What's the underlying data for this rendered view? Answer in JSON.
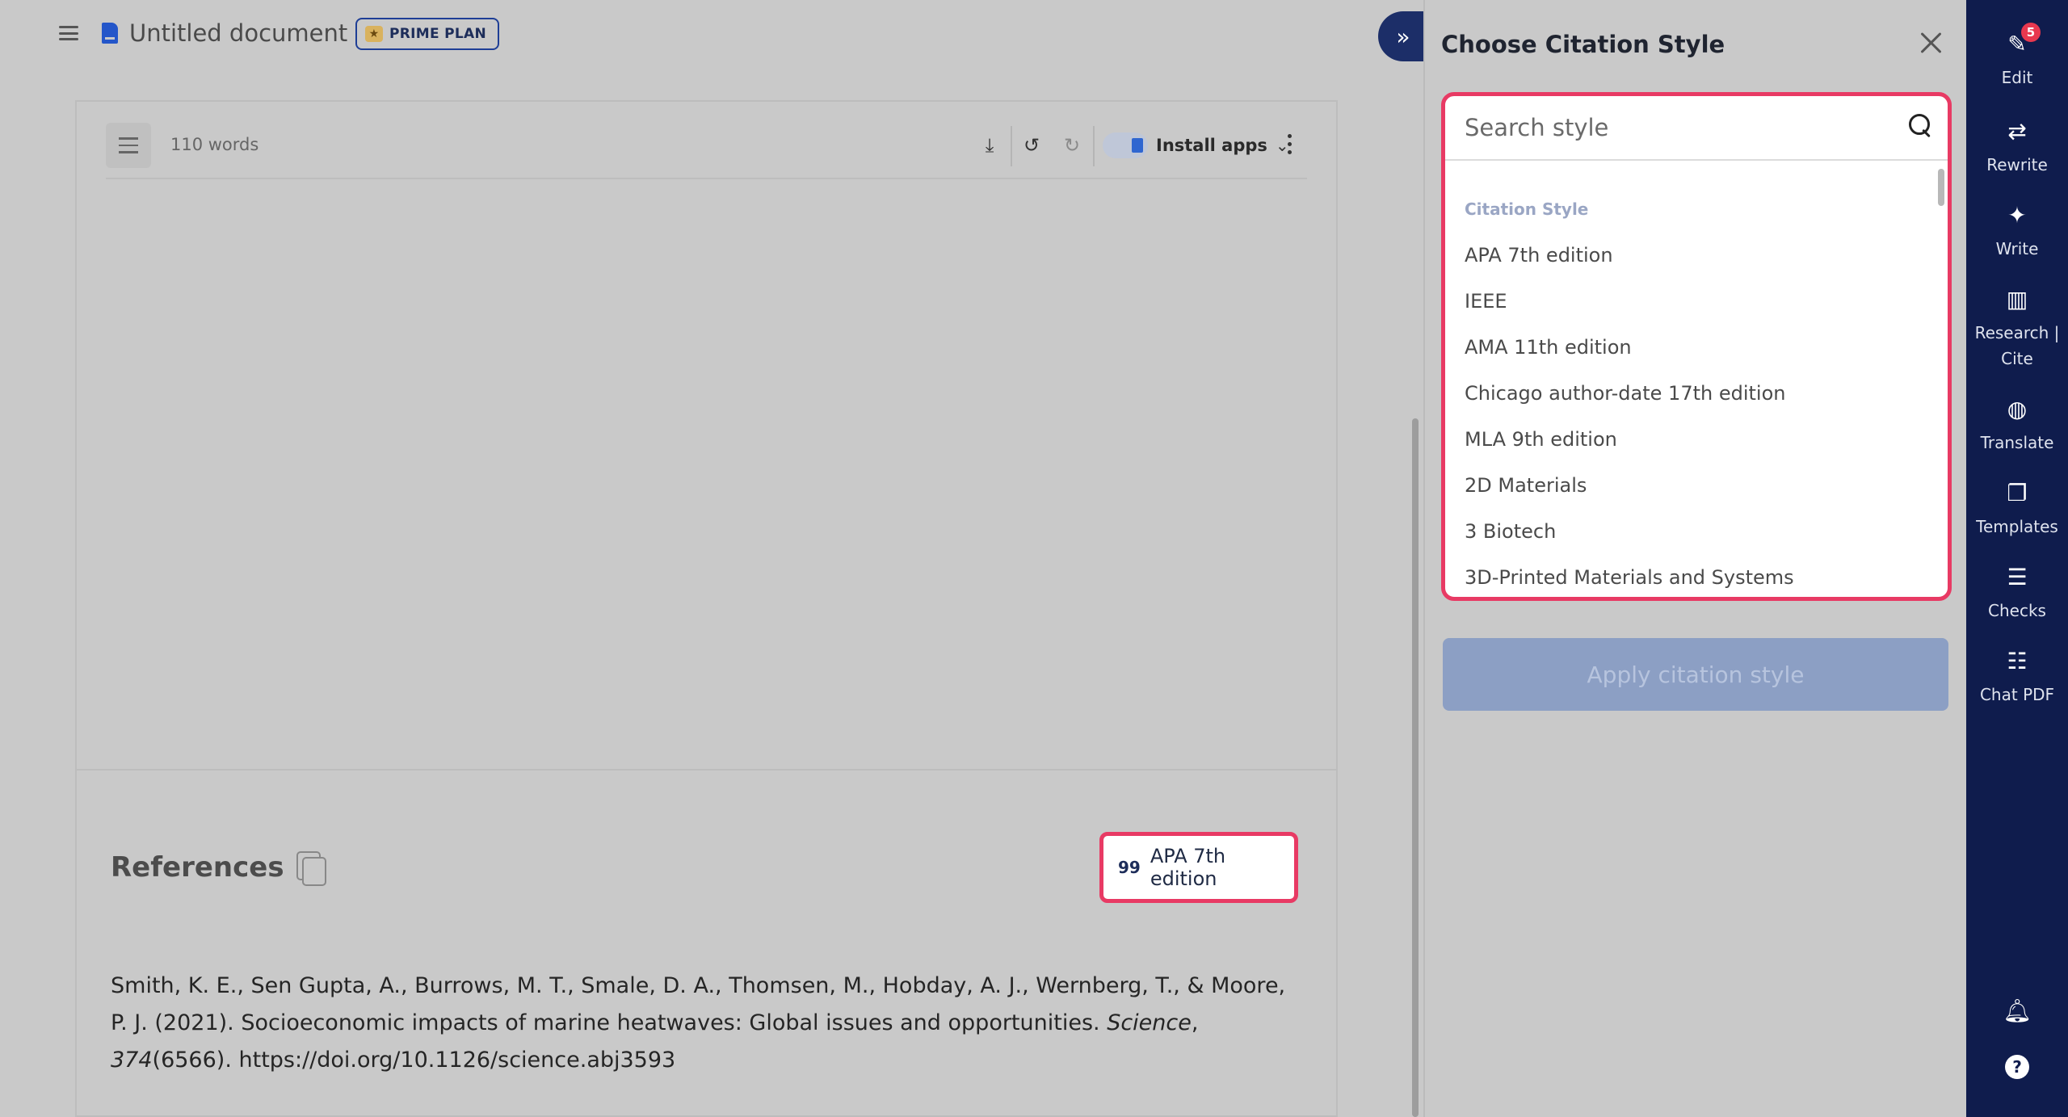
{
  "header": {
    "doc_title": "Untitled document",
    "plan_badge": "PRIME PLAN"
  },
  "editor": {
    "word_count": "110 words",
    "install_apps": "Install apps"
  },
  "references": {
    "title": "References",
    "style_chip_label": "APA 7th edition",
    "quote_glyph": "99",
    "entry_part1": "Smith, K. E., Sen Gupta, A., Burrows, M. T., Smale, D. A., Thomsen, M., Hobday, A. J., Wernberg, T., & Moore, P. J. (2021). Socioeconomic impacts of marine heatwaves: Global issues and opportunities. ",
    "entry_journal": "Science",
    "entry_sep": ", ",
    "entry_volume": "374",
    "entry_part2": "(6566). https://doi.org/10.1126/science.abj3593"
  },
  "citation_panel": {
    "title": "Choose Citation Style",
    "search_placeholder": "Search style",
    "list_heading": "Citation Style",
    "styles": [
      "APA 7th edition",
      "IEEE",
      "AMA 11th edition",
      "Chicago author-date 17th edition",
      "MLA 9th edition",
      "2D Materials",
      "3 Biotech",
      "3D-Printed Materials and Systems"
    ],
    "apply_label": "Apply citation style"
  },
  "rail": {
    "items": [
      {
        "label": "Edit",
        "icon": "pen-icon",
        "badge": "5"
      },
      {
        "label": "Rewrite",
        "icon": "rewrite-icon"
      },
      {
        "label": "Write",
        "icon": "sparkle-icon"
      },
      {
        "label": "Research |\nCite",
        "icon": "books-icon"
      },
      {
        "label": "Translate",
        "icon": "globe-icon"
      },
      {
        "label": "Templates",
        "icon": "templates-icon"
      },
      {
        "label": "Checks",
        "icon": "checklist-icon"
      },
      {
        "label": "Chat PDF",
        "icon": "chat-icon"
      }
    ]
  },
  "colors": {
    "accent_dark": "#0f1c4d",
    "highlight": "#e83a64",
    "apply_disabled": "#8c9fc4"
  }
}
